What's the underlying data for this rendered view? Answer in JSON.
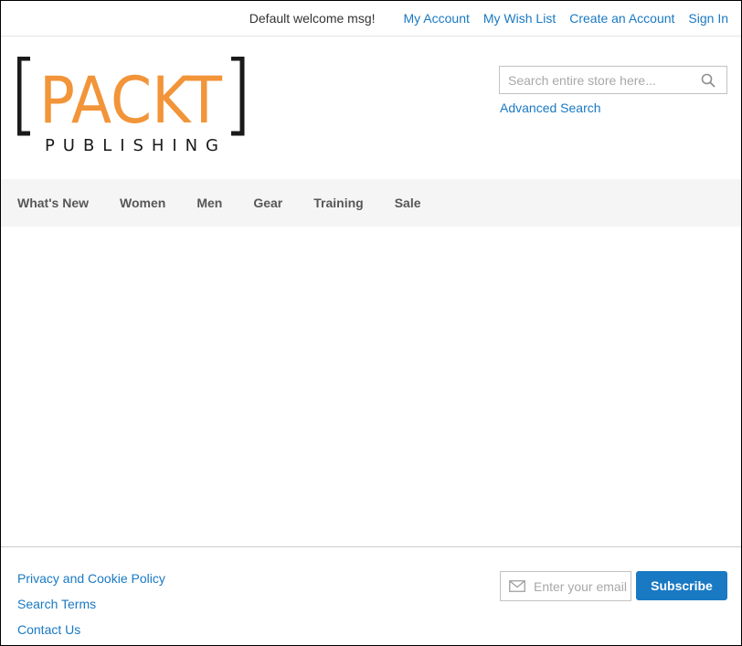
{
  "colors": {
    "link": "#1979c3",
    "brand_orange": "#f29439",
    "nav_background": "#f5f5f5",
    "button": "#1979c3"
  },
  "topbar": {
    "welcome": "Default welcome msg!",
    "links": [
      "My Account",
      "My Wish List",
      "Create an Account",
      "Sign In"
    ]
  },
  "logo": {
    "main": "PACKT",
    "sub": "PUBLISHING"
  },
  "search": {
    "placeholder": "Search entire store here...",
    "value": "",
    "icon": "search-icon",
    "advanced_label": "Advanced Search"
  },
  "nav": {
    "items": [
      "What's New",
      "Women",
      "Men",
      "Gear",
      "Training",
      "Sale"
    ]
  },
  "footer": {
    "links": [
      "Privacy and Cookie Policy",
      "Search Terms",
      "Contact Us"
    ],
    "newsletter": {
      "placeholder": "Enter your email address",
      "value": "",
      "icon": "envelope-icon",
      "button_label": "Subscribe"
    }
  }
}
